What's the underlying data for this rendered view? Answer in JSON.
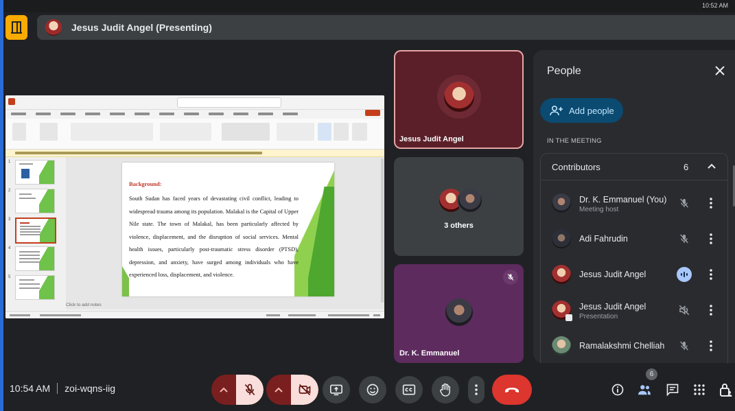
{
  "os": {
    "clock": "10:52 AM"
  },
  "topbar": {
    "presenting_label": "Jesus Judit Angel (Presenting)"
  },
  "powerpoint": {
    "slide_title": "Background:",
    "slide_body": "South Sudan has faced years of devastating civil conflict, leading to widespread trauma among its population. Malakal is the Capital of Upper Nile state. The town of Malakal, has been particularly affected by violence, displacement, and the disruption of social services. Mental health issues, particularly post-traumatic stress disorder (PTSD), depression, and anxiety, have surged among individuals who have experienced loss, displacement, and violence.",
    "notes_placeholder": "Click to add notes",
    "thumbnail_numbers": [
      "1",
      "2",
      "3",
      "4",
      "5"
    ]
  },
  "tiles": {
    "tile1_name": "Jesus Judit Angel",
    "tile2_label": "3 others",
    "tile3_name": "Dr. K. Emmanuel"
  },
  "people_panel": {
    "title": "People",
    "add_people_label": "Add people",
    "section_label": "IN THE MEETING",
    "contributors_label": "Contributors",
    "contributors_count": "6",
    "participants": [
      {
        "name": "Dr. K. Emmanuel (You)",
        "subtitle": "Meeting host",
        "mic": "muted"
      },
      {
        "name": "Adi Fahrudin",
        "subtitle": "",
        "mic": "muted"
      },
      {
        "name": "Jesus Judit Angel",
        "subtitle": "",
        "mic": "speaking"
      },
      {
        "name": "Jesus Judit Angel",
        "subtitle": "Presentation",
        "mic": "audio-off"
      },
      {
        "name": "Ramalakshmi Chelliah",
        "subtitle": "",
        "mic": "muted"
      }
    ]
  },
  "bottom_bar": {
    "time": "10:54 AM",
    "meeting_code": "zoi-wqns-iig",
    "people_badge": "6"
  },
  "colors": {
    "accent_yellow": "#f9ab00",
    "leave_red": "#dc362e",
    "add_people_bg": "#0b4a71",
    "speaking_blue": "#a8c7fa"
  }
}
